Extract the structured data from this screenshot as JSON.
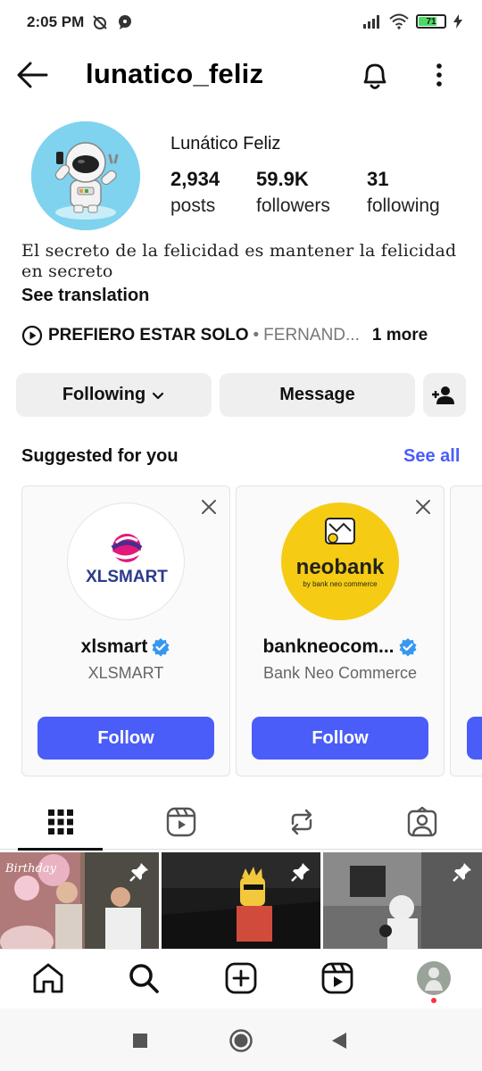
{
  "status_bar": {
    "time": "2:05 PM",
    "battery": "71"
  },
  "header": {
    "username": "lunatico_feliz"
  },
  "profile": {
    "display_name": "Lunático Feliz",
    "stats": [
      {
        "value": "2,934",
        "label": "posts"
      },
      {
        "value": "59.9K",
        "label": "followers"
      },
      {
        "value": "31",
        "label": "following"
      }
    ],
    "bio": "El secreto de la felicidad es mantener la felicidad en secreto",
    "see_translation": "See translation",
    "music": {
      "title": "PREFIERO ESTAR SOLO",
      "separator": "•",
      "artist": "FERNAND...",
      "more": "1 more"
    }
  },
  "actions": {
    "following": "Following",
    "message": "Message"
  },
  "suggested": {
    "title": "Suggested for you",
    "see_all": "See all",
    "cards": [
      {
        "name": "xlsmart",
        "subtitle": "XLSMART",
        "follow": "Follow",
        "logo_text": "XLSMART"
      },
      {
        "name": "bankneocom...",
        "subtitle": "Bank Neo Commerce",
        "follow": "Follow",
        "logo_text": "neobank",
        "logo_subtext": "by bank neo commerce"
      }
    ]
  },
  "tabs": [
    "grid-icon",
    "reels-icon",
    "reposts-icon",
    "tagged-icon"
  ],
  "thumbs": [
    {
      "caption": "Birthday"
    },
    {
      "caption": ""
    },
    {
      "caption": ""
    }
  ],
  "colors": {
    "accent": "#4a5df9",
    "verified": "#3797f0",
    "neobank_yellow": "#f5cc13"
  }
}
